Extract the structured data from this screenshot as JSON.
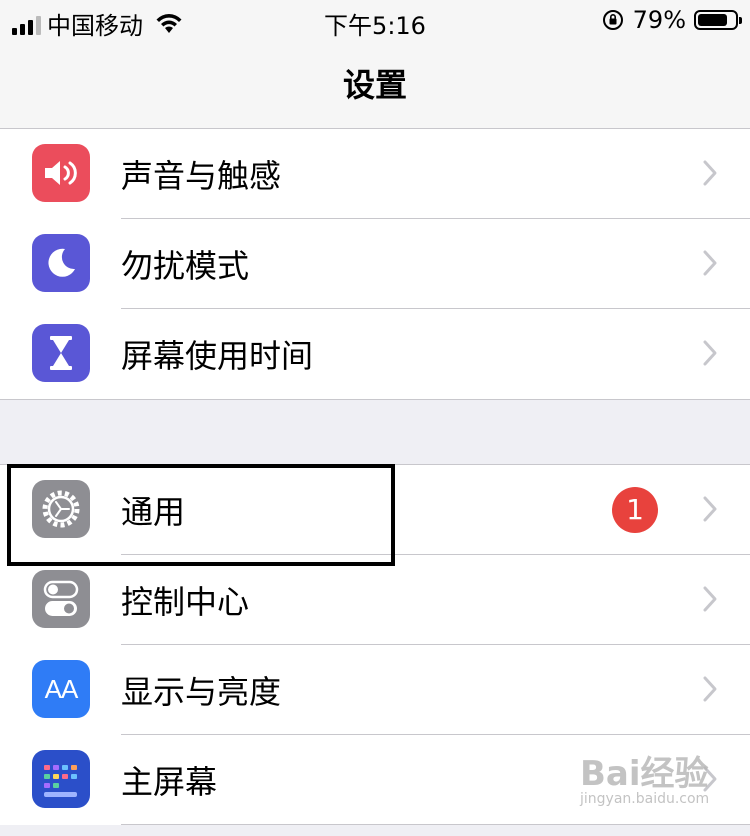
{
  "status_bar": {
    "carrier": "中国移动",
    "time": "下午5:16",
    "battery": "79%"
  },
  "nav": {
    "title": "设置"
  },
  "sections": [
    {
      "items": [
        {
          "label": "声音与触感",
          "icon": "speaker-icon",
          "color": "#eb4d5c"
        },
        {
          "label": "勿扰模式",
          "icon": "moon-icon",
          "color": "#5a57d6"
        },
        {
          "label": "屏幕使用时间",
          "icon": "hourglass-icon",
          "color": "#5a57d6"
        }
      ]
    },
    {
      "items": [
        {
          "label": "通用",
          "icon": "gear-icon",
          "color": "#8e8e93",
          "badge": "1"
        },
        {
          "label": "控制中心",
          "icon": "toggles-icon",
          "color": "#8e8e93"
        },
        {
          "label": "显示与亮度",
          "icon": "text-size-icon",
          "color": "#2f7cf6",
          "icon_text": "AA"
        },
        {
          "label": "主屏幕",
          "icon": "home-grid-icon",
          "color": "#2b4fc9"
        }
      ]
    }
  ],
  "watermark": {
    "main": "Bai经验",
    "sub": "jingyan.baidu.com"
  }
}
